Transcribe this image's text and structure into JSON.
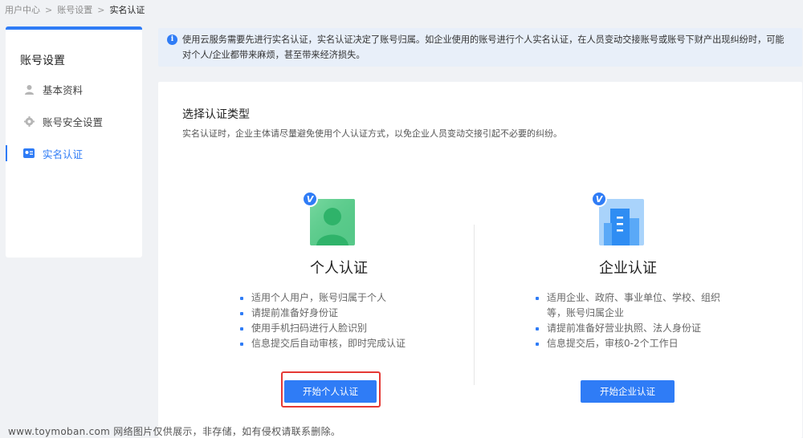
{
  "breadcrumb": {
    "items": [
      "用户中心",
      "账号设置",
      "实名认证"
    ],
    "separator": ">"
  },
  "sidebar": {
    "title": "账号设置",
    "items": [
      {
        "label": "基本资料",
        "icon": "user-icon"
      },
      {
        "label": "账号安全设置",
        "icon": "gear-icon"
      },
      {
        "label": "实名认证",
        "icon": "id-card-icon",
        "active": true
      }
    ]
  },
  "notice": {
    "icon": "info-icon",
    "text": "使用云服务需要先进行实名认证，实名认证决定了账号归属。如企业使用的账号进行个人实名认证，在人员变动交接账号或账号下财产出现纠纷时，可能对个人/企业都带来麻烦，甚至带来经济损失。"
  },
  "main": {
    "title": "选择认证类型",
    "description": "实名认证时，企业主体请尽量避免使用个人认证方式，以免企业人员变动交接引起不必要的纠纷。",
    "options": [
      {
        "badge": "V",
        "title": "个人认证",
        "icon": "person-icon",
        "bullets": [
          "适用个人用户，账号归属于个人",
          "请提前准备好身份证",
          "使用手机扫码进行人脸识别",
          "信息提交后自动审核，即时完成认证"
        ],
        "button": "开始个人认证"
      },
      {
        "badge": "V",
        "title": "企业认证",
        "icon": "building-icon",
        "bullets": [
          "适用企业、政府、事业单位、学校、组织等，账号归属企业",
          "请提前准备好营业执照、法人身份证",
          "信息提交后，审核0-2个工作日"
        ],
        "button": "开始企业认证"
      }
    ]
  },
  "watermark": "www.toymoban.com 网络图片仅供展示，非存储，如有侵权请联系删除。",
  "colors": {
    "accent": "#2f7cf6",
    "highlight": "#e53935",
    "background": "#f0f2f5"
  }
}
